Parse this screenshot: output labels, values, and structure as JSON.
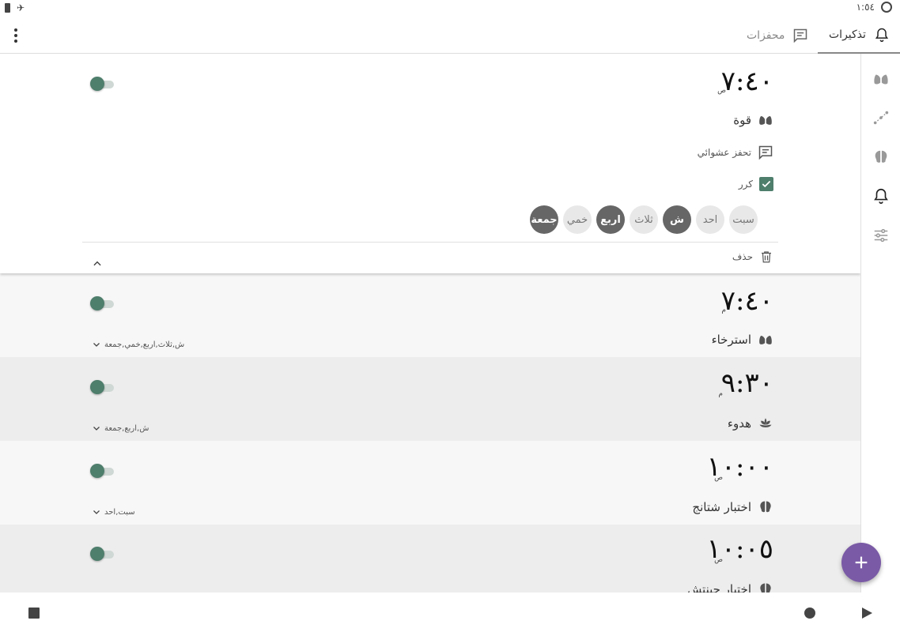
{
  "status_bar": {
    "time": "١:٥٤",
    "icons": [
      "battery-icon",
      "airplane-icon",
      "sync-icon"
    ]
  },
  "app_bar": {
    "tabs": [
      {
        "label": "تذكيرات",
        "icon": "bell-icon",
        "selected": true
      },
      {
        "label": "محفزات",
        "icon": "message-icon",
        "selected": false
      }
    ],
    "overflow_icon": "more-vert-icon"
  },
  "rail": {
    "items": [
      "lungs-icon",
      "path-icon",
      "brain-icon",
      "bell-icon",
      "sliders-icon"
    ]
  },
  "colors": {
    "accent": "#4e7e6c",
    "fab": "#7a5aa6",
    "chip_on": "#666666"
  },
  "reminders": [
    {
      "time": "٧:٤٠",
      "ampm": "ص",
      "enabled": true,
      "expanded": true,
      "exercise": "قوة",
      "exercise_icon": "lungs-icon",
      "motivation": "تحفز عشوائي",
      "motivation_icon": "message-icon",
      "repeat_label": "كرر",
      "repeat_checked": true,
      "days": [
        {
          "label": "سبت",
          "on": false
        },
        {
          "label": "احد",
          "on": false
        },
        {
          "label": "ش",
          "on": true
        },
        {
          "label": "ثلاث",
          "on": false
        },
        {
          "label": "اربع",
          "on": true
        },
        {
          "label": "خمي",
          "on": false
        },
        {
          "label": "جمعة",
          "on": true
        }
      ],
      "delete_label": "حذف"
    },
    {
      "time": "٧:٤٠",
      "ampm": "م",
      "enabled": true,
      "exercise": "استرخاء",
      "exercise_icon": "lungs-icon",
      "days_summary": "ش,ثلاث,اربع,خمي,جمعة"
    },
    {
      "time": "٩:٣٠",
      "ampm": "م",
      "enabled": true,
      "exercise": "هدوء",
      "exercise_icon": "lotus-icon",
      "days_summary": "ش,اربع,جمعة"
    },
    {
      "time": "١٠:٠٠",
      "ampm": "ص",
      "enabled": true,
      "exercise": "اختبار شتانج",
      "exercise_icon": "brain-icon",
      "days_summary": "سبت,احد"
    },
    {
      "time": "١٠:٠٥",
      "ampm": "ص",
      "enabled": true,
      "exercise": "اختبار جينتش",
      "exercise_icon": "brain-icon"
    }
  ],
  "fab": {
    "icon": "plus-icon"
  },
  "system_nav": {
    "icons": [
      "stop-icon",
      "home-circle-icon",
      "back-play-icon"
    ]
  }
}
